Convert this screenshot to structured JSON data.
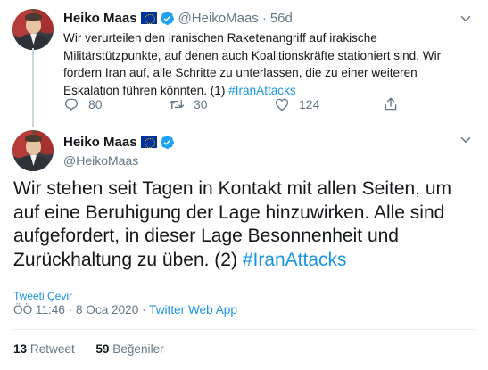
{
  "tweet1": {
    "name": "Heiko Maas",
    "handle": "@HeikoMaas",
    "separator": "·",
    "time": "56d",
    "text": "Wir verurteilen den iranischen Raketenangriff auf irakische Militärstützpunkte, auf denen auch Koalitionskräfte stationiert sind. Wir fordern Iran auf, alle Schritte zu unterlassen, die zu einer weiteren Eskalation führen könnten. (1) ",
    "hashtag": "#IranAttacks",
    "replies": "80",
    "retweets": "30",
    "likes": "124"
  },
  "tweet2": {
    "name": "Heiko Maas",
    "handle": "@HeikoMaas",
    "text": "Wir stehen seit Tagen in Kontakt mit allen Seiten, um auf eine Beruhigung der Lage hinzuwirken. Alle sind aufgefordert, in dieser Lage Besonnenheit und Zurückhaltung zu üben. (2) ",
    "hashtag": "#IranAttacks",
    "translate_label": "Tweeti Çevir",
    "timestamp": "ÖÖ 11:46 · 8 Oca 2020",
    "meta_sep": " · ",
    "source": "Twitter Web App",
    "retweet_count": "13",
    "retweet_label": "Retweet",
    "like_count": "59",
    "like_label": "Beğeniler"
  },
  "colors": {
    "link": "#1b95e0",
    "muted": "#657786",
    "text": "#14171a",
    "verified": "#1da1f2"
  }
}
